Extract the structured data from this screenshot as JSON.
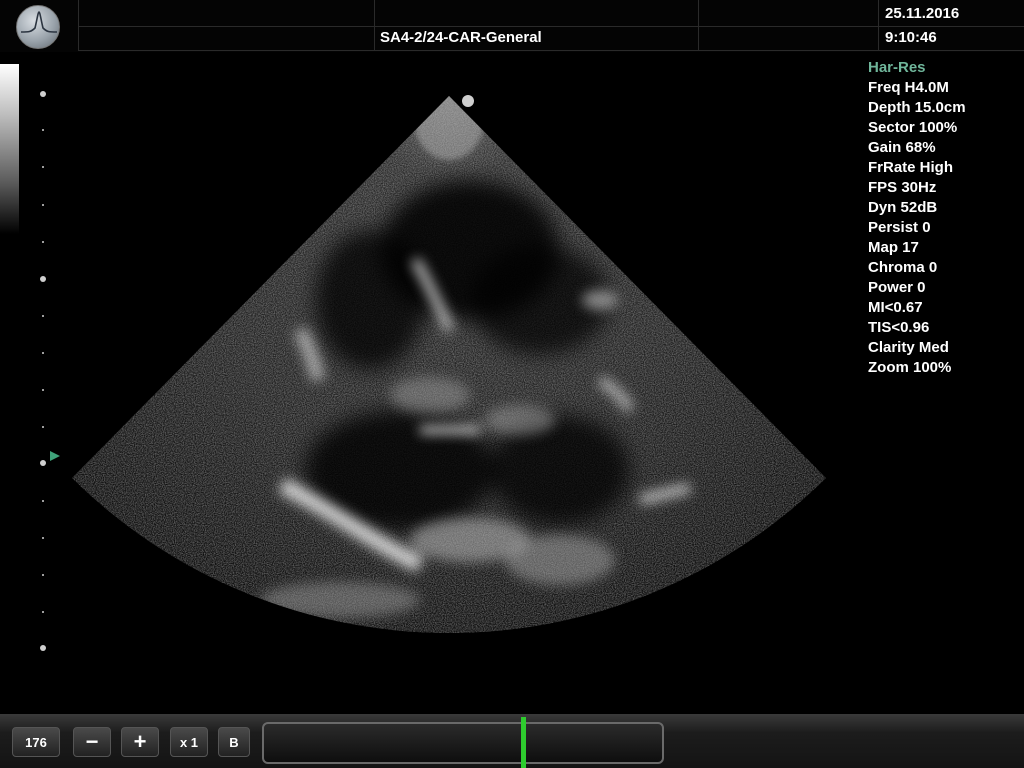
{
  "header": {
    "preset": "SA4-2/24-CAR-General",
    "date": "25.11.2016",
    "time": "9:10:46"
  },
  "parameters": [
    {
      "text": "Har-Res",
      "accent": true
    },
    {
      "text": "Freq H4.0M"
    },
    {
      "text": "Depth 15.0cm"
    },
    {
      "text": "Sector 100%"
    },
    {
      "text": "Gain 68%"
    },
    {
      "text": "FrRate High"
    },
    {
      "text": "FPS 30Hz"
    },
    {
      "text": "Dyn 52dB"
    },
    {
      "text": "Persist 0"
    },
    {
      "text": "Map 17"
    },
    {
      "text": "Chroma 0"
    },
    {
      "text": "Power 0"
    },
    {
      "text": "MI<0.67"
    },
    {
      "text": "TIS<0.96"
    },
    {
      "text": "Clarity Med"
    },
    {
      "text": "Zoom 100%"
    }
  ],
  "controls": {
    "frame_counter": "176",
    "minus_label": "−",
    "plus_label": "+",
    "speed_label": "x 1",
    "mode_label": "B"
  },
  "cine": {
    "position_fraction": 0.65
  },
  "colors": {
    "accent": "#6fb59a",
    "focus_marker": "#3fa37a",
    "cine_marker": "#2ecc2e"
  },
  "icons": {
    "logo": "waveform-logo-icon",
    "focus": "focus-arrow-icon"
  }
}
